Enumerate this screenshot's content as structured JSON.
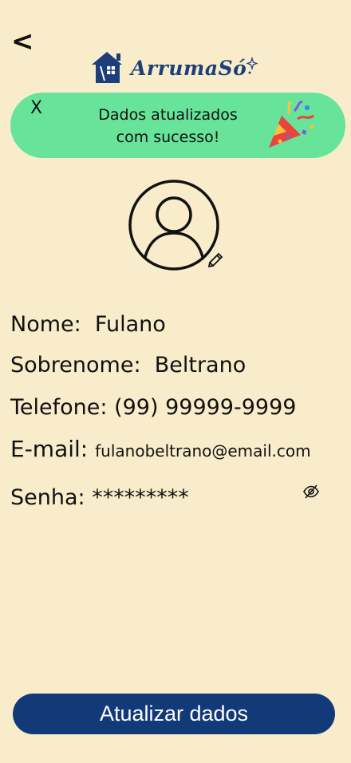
{
  "header": {
    "back_label": "<",
    "logo_text": "ArrumaSó"
  },
  "toast": {
    "close_label": "X",
    "message_line1": "Dados atualizados",
    "message_line2": "com sucesso!",
    "icon": "party-popper-icon"
  },
  "profile": {
    "avatar_icon": "user-avatar-icon",
    "edit_icon": "pencil-icon"
  },
  "fields": {
    "nome_label": "Nome:",
    "nome_value": "Fulano",
    "sobrenome_label": "Sobrenome:",
    "sobrenome_value": "Beltrano",
    "telefone_label": "Telefone:",
    "telefone_value": "(99) 99999-9999",
    "email_label": "E-mail:",
    "email_value": "fulanobeltrano@email.com",
    "senha_label": "Senha:",
    "senha_value": "*********",
    "senha_toggle_icon": "eye-off-icon"
  },
  "actions": {
    "update_label": "Atualizar dados"
  },
  "colors": {
    "background": "#f8ecca",
    "toast": "#67e39a",
    "primary": "#123a78"
  }
}
